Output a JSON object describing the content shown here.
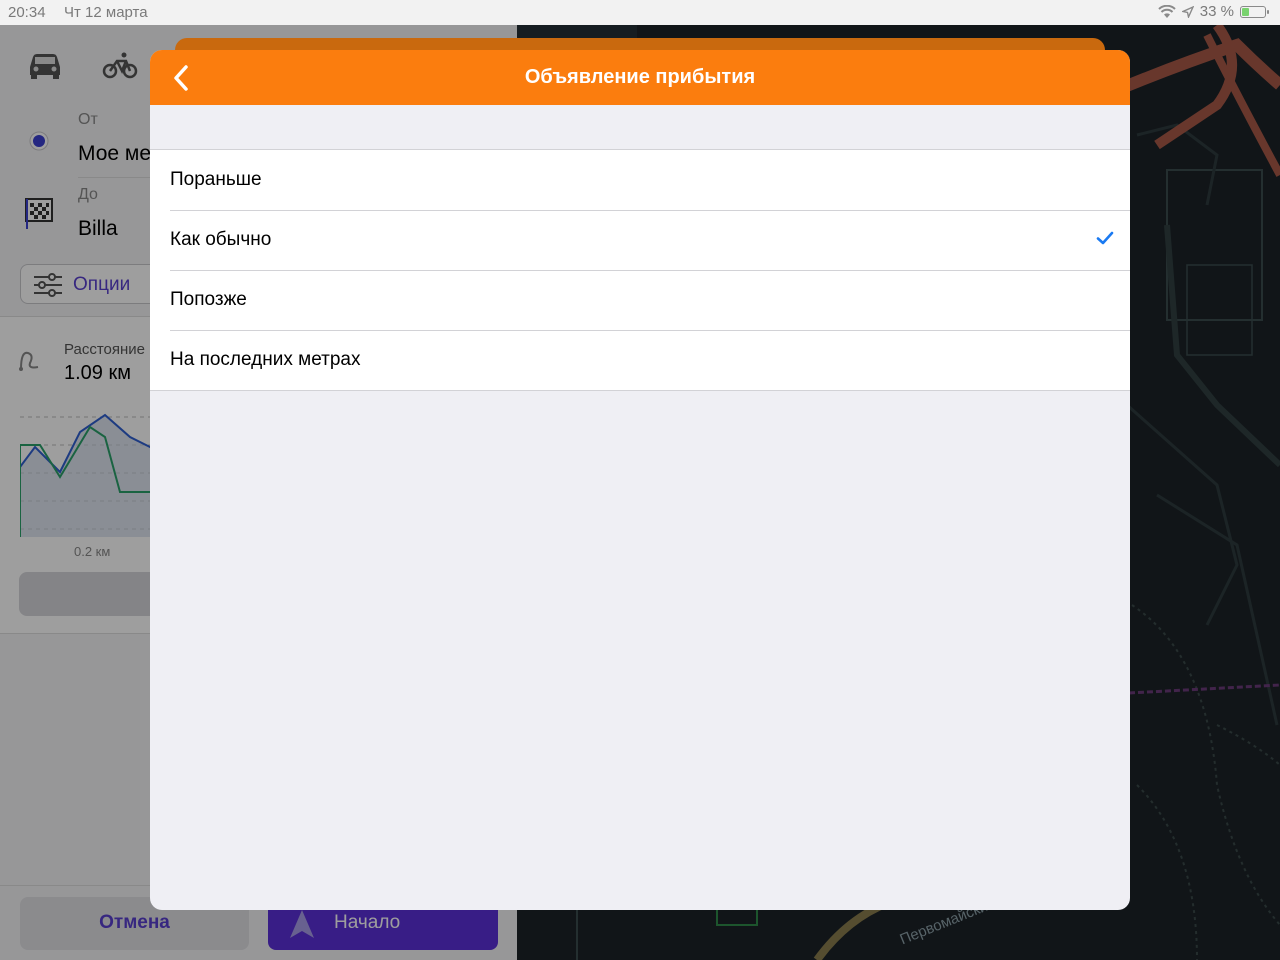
{
  "status_bar": {
    "time": "20:34",
    "date": "Чт 12 марта",
    "battery": "33 %",
    "battery_level": 0.33,
    "icons": [
      "wifi-icon",
      "location-arrow-icon",
      "battery-charging-icon"
    ]
  },
  "left_panel": {
    "modes": [
      "car-icon",
      "bicycle-icon"
    ],
    "from_label": "От",
    "from_value": "Мое ме",
    "to_label": "До",
    "to_value": "Billa",
    "options_label": "Опции",
    "distance_label": "Расстояние",
    "distance_value": "1.09 км",
    "chart_axis_label": "0.2 км",
    "cancel_label": "Отмена",
    "start_label": "Начало"
  },
  "map": {
    "street_label": "Первомайский"
  },
  "modal": {
    "title": "Объявление прибытия",
    "options": [
      {
        "label": "Пораньше",
        "selected": false
      },
      {
        "label": "Как обычно",
        "selected": true
      },
      {
        "label": "Попозже",
        "selected": false
      },
      {
        "label": "На последних метрах",
        "selected": false
      }
    ]
  },
  "colors": {
    "header": "#fb7d0e",
    "check": "#1a7af2",
    "accent": "#5b2fd8"
  }
}
